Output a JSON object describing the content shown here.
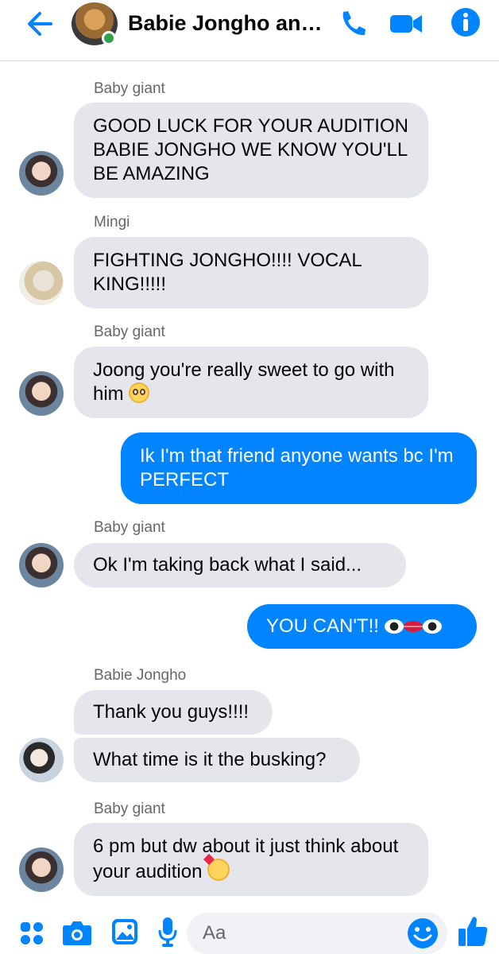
{
  "header": {
    "title": "Babie Jongho and ..."
  },
  "colors": {
    "accent": "#0084ff",
    "incoming_bubble": "#e4e6eb",
    "online": "#31a24c"
  },
  "messages": [
    {
      "sender": "Baby giant",
      "text": "GOOD LUCK FOR YOUR AUDITION BABIE JONGHO WE KNOW YOU'LL BE AMAZING"
    },
    {
      "sender": "Mingi",
      "text": "FIGHTING JONGHO!!!! VOCAL KING!!!!!"
    },
    {
      "sender": "Baby giant",
      "text": "Joong you're really sweet to go with him",
      "emoji": "pleading-face-emoji"
    },
    {
      "sender": "",
      "text": "Ik I'm that friend anyone wants bc I'm PERFECT"
    },
    {
      "sender": "Baby giant",
      "text": "Ok I'm taking back what I said..."
    },
    {
      "sender": "",
      "text": "YOU CAN'T!!",
      "emoji": "eye-lips-eye-emoji"
    },
    {
      "sender": "Babie Jongho",
      "text": "Thank you guys!!!!"
    },
    {
      "sender": "",
      "text": "What time is it the busking?"
    },
    {
      "sender": "Baby giant",
      "text": "6 pm but dw about it just think about your audition",
      "emoji": "smiling-face-with-hearts-emoji"
    }
  ],
  "composer": {
    "placeholder": "Aa"
  },
  "icons": [
    "back-arrow-icon",
    "phone-icon",
    "video-camera-icon",
    "info-icon",
    "apps-icon",
    "camera-icon",
    "gallery-icon",
    "microphone-icon",
    "emoji-icon",
    "like-icon"
  ]
}
